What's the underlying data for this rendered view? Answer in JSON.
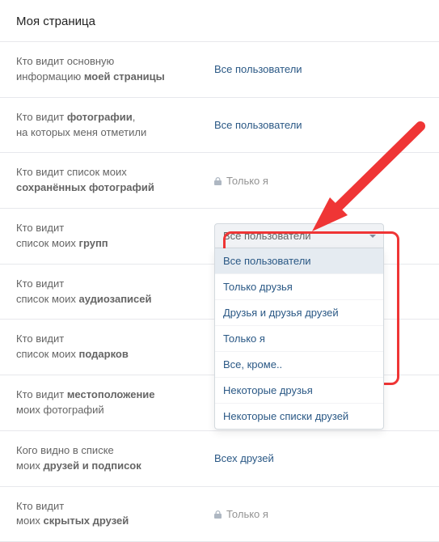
{
  "title": "Моя страница",
  "rows": {
    "r0": {
      "label_a": "Кто видит основную",
      "label_b": "информацию ",
      "bold": "моей страницы",
      "value": "Все пользователи"
    },
    "r1": {
      "label_a": "Кто видит ",
      "bold": "фотографии",
      "label_b": ",",
      "label_c": "на которых меня отметили",
      "value": "Все пользователи"
    },
    "r2": {
      "label_a": "Кто видит список моих",
      "bold": "сохранённых фотографий",
      "value": "Только я"
    },
    "r3": {
      "label_a": "Кто видит",
      "label_b": "список моих ",
      "bold": "групп",
      "selected": "Все пользователи"
    },
    "r4": {
      "label_a": "Кто видит",
      "label_b": "список моих ",
      "bold": "аудиозаписей",
      "value": ""
    },
    "r5": {
      "label_a": "Кто видит",
      "label_b": "список моих ",
      "bold": "подарков",
      "value": ""
    },
    "r6": {
      "label_a": "Кто видит ",
      "bold": "местоположение",
      "label_b": "моих фотографий",
      "value": ""
    },
    "r7": {
      "label_a": "Кого видно в списке",
      "label_b": "моих ",
      "bold": "друзей и подписок",
      "value": "Всех друзей"
    },
    "r8": {
      "label_a": "Кто видит",
      "label_b": "моих ",
      "bold": "скрытых друзей",
      "value": "Только я"
    }
  },
  "dropdown_options": [
    "Все пользователи",
    "Только друзья",
    "Друзья и друзья друзей",
    "Только я",
    "Все, кроме..",
    "Некоторые друзья",
    "Некоторые списки друзей"
  ],
  "colors": {
    "link": "#2a5885",
    "red": "#ef3535"
  }
}
